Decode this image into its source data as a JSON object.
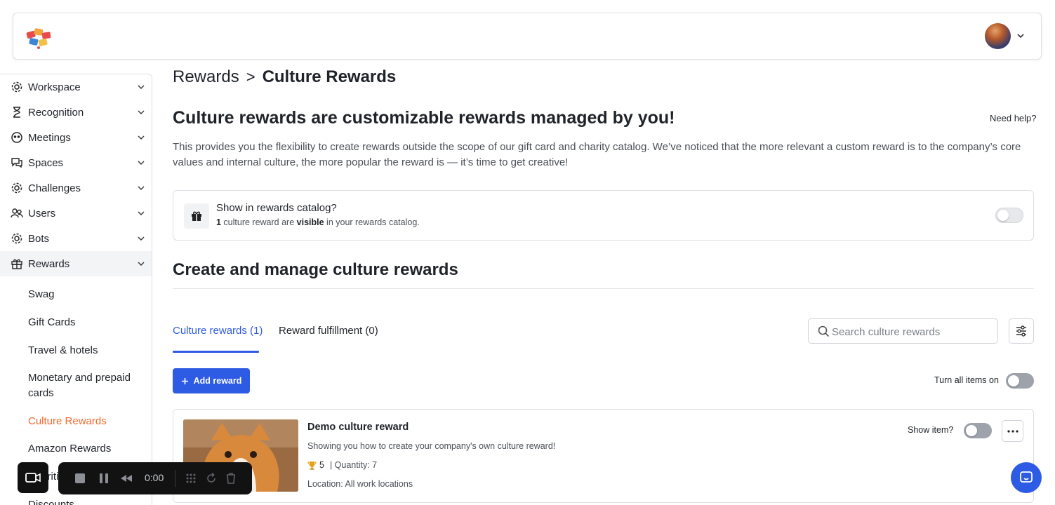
{
  "header": {
    "logo_icon": "app-logo-icon",
    "avatar_icon": "user-avatar",
    "menu_icon": "chevron-down-icon"
  },
  "sidebar": {
    "items": [
      {
        "label": "Workspace",
        "icon": "gear-icon"
      },
      {
        "label": "Recognition",
        "icon": "hourglass-icon"
      },
      {
        "label": "Meetings",
        "icon": "meetings-icon"
      },
      {
        "label": "Spaces",
        "icon": "chat-bubbles-icon"
      },
      {
        "label": "Challenges",
        "icon": "gear-icon"
      },
      {
        "label": "Users",
        "icon": "users-icon"
      },
      {
        "label": "Bots",
        "icon": "gear-icon"
      },
      {
        "label": "Rewards",
        "icon": "gift-icon"
      }
    ],
    "rewards_sub": [
      "Swag",
      "Gift Cards",
      "Travel & hotels",
      "Monetary and prepaid cards",
      "Culture Rewards",
      "Amazon Rewards",
      "Charities",
      "Discounts"
    ],
    "active_sub": "Culture Rewards"
  },
  "breadcrumb": {
    "root": "Rewards",
    "separator": ">",
    "current": "Culture Rewards"
  },
  "main": {
    "title": "Culture rewards are customizable rewards managed by you!",
    "help_link": "Need help?",
    "description": "This provides you the flexibility to create rewards outside the scope of our gift card and charity catalog. We’ve noticed that the more relevant a custom reward is to the company’s core values and internal culture, the more popular the reward is — it’s time to get creative!"
  },
  "catalog": {
    "title": "Show in rewards catalog?",
    "count": "1",
    "sub_middle": " culture reward are ",
    "sub_bold": "visible",
    "sub_end": " in your rewards catalog.",
    "toggle_on": false
  },
  "manage": {
    "title": "Create and manage culture rewards"
  },
  "tabs": [
    {
      "label": "Culture rewards (1)",
      "active": true
    },
    {
      "label": "Reward fulfillment (0)",
      "active": false
    }
  ],
  "search": {
    "placeholder": "Search culture rewards",
    "value": ""
  },
  "toolbar": {
    "add_label": "Add reward",
    "turn_all_label": "Turn all items on",
    "turn_all_on": false
  },
  "reward": {
    "title": "Demo culture reward",
    "description": "Showing you how to create your company's own culture reward!",
    "points": "5",
    "quantity": "| Quantity: 7",
    "location": "Location: All work locations",
    "show_item_label": "Show item?",
    "show_item_on": false,
    "image": "corgi-dog-photo"
  },
  "recorder": {
    "time": "0:00"
  },
  "colors": {
    "accent": "#2d5be3",
    "active_nav": "#f26a2e",
    "text": "#1f2329"
  }
}
